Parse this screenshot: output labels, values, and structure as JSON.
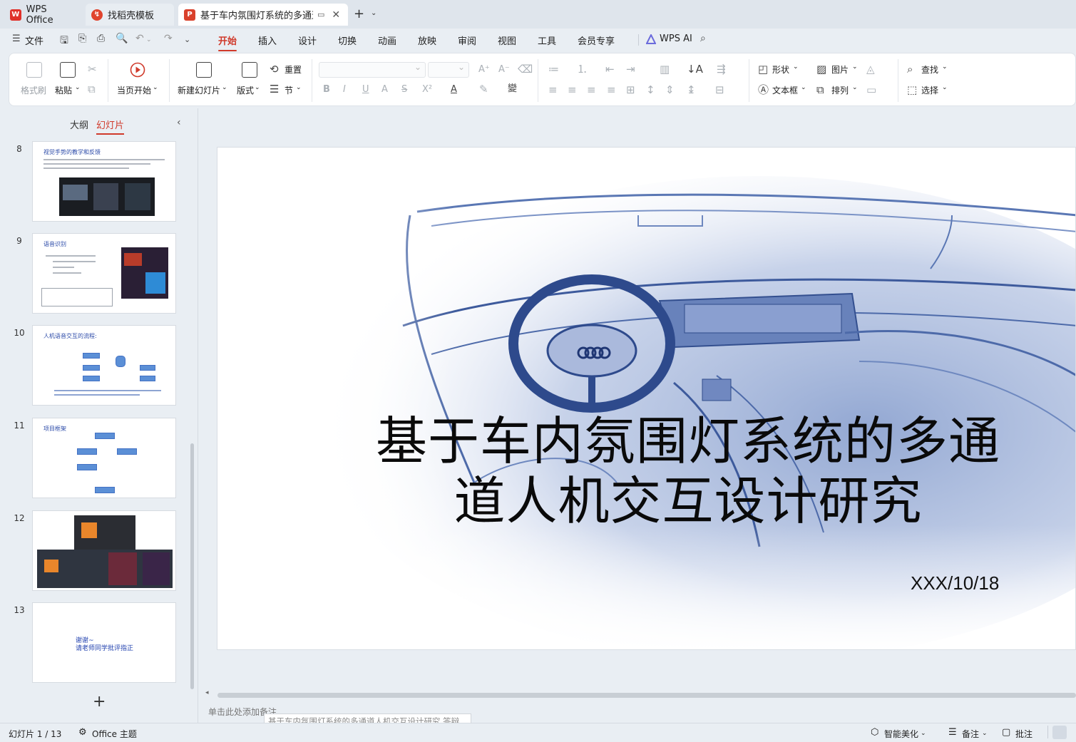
{
  "tabs": {
    "wps": "WPS Office",
    "template": "找稻壳模板",
    "document": "基于车内氛围灯系统的多通道人机交互设计研究"
  },
  "menubar": {
    "file": "文件",
    "tabs": [
      "开始",
      "插入",
      "设计",
      "切换",
      "动画",
      "放映",
      "审阅",
      "视图",
      "工具",
      "会员专享"
    ],
    "active_tab": "开始",
    "wps_ai": "WPS AI"
  },
  "ribbon": {
    "format_painter": "格式刷",
    "paste": "粘贴",
    "start_from_current": "当页开始",
    "new_slide": "新建幻灯片",
    "layout": "版式",
    "reset": "重置",
    "section": "节",
    "shape": "形状",
    "picture": "图片",
    "textbox": "文本框",
    "arrange": "排列",
    "find": "查找",
    "select": "选择"
  },
  "left_panel": {
    "tab_outline": "大纲",
    "tab_slides": "幻灯片",
    "slides": [
      {
        "num": "8",
        "title": "视觉手势的教学和反馈"
      },
      {
        "num": "9",
        "title": "语音识别"
      },
      {
        "num": "10",
        "title": "人机语音交互的流程:"
      },
      {
        "num": "11",
        "title": "项目框架"
      },
      {
        "num": "12",
        "title": ""
      },
      {
        "num": "13",
        "title": "谢谢~\n请老师同学批评指正"
      }
    ],
    "add": "+"
  },
  "slide": {
    "title": "基于车内氛围灯系统的多通道人机交互设计研究",
    "date": "XXX/10/18"
  },
  "notes_placeholder": "单击此处添加备注",
  "tooltip": "基于车内氛围灯系统的多通道人机交互设计研究 答辩PPT.pptx - WPS Office",
  "statusbar": {
    "slide_counter": "幻灯片 1 / 13",
    "theme": "Office 主题",
    "smart_beautify": "智能美化",
    "notes": "备注",
    "comments": "批注"
  },
  "colors": {
    "accent": "#d03a2b",
    "slide_blue": "#3b5ea8"
  }
}
